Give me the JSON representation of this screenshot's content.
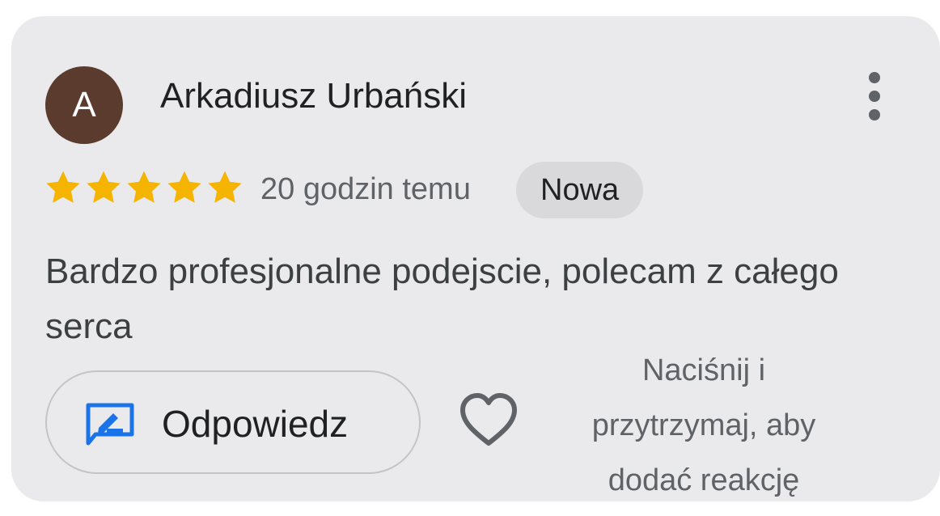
{
  "review": {
    "avatar_letter": "A",
    "author": "Arkadiusz Urbański",
    "rating": 5,
    "time": "20 godzin temu",
    "badge": "Nowa",
    "text": "Bardzo profesjonalne podejscie, polecam z całego serca"
  },
  "actions": {
    "reply_label": "Odpowiedz",
    "reaction_hint": "Naciśnij i przytrzymaj, aby dodać reakcję"
  },
  "icons": {
    "more": "more-vertical-icon",
    "star": "star-icon",
    "reply": "reply-edit-icon",
    "heart": "heart-outline-icon"
  },
  "colors": {
    "card_bg": "#eaeaec",
    "avatar_bg": "#5b3b2e",
    "star": "#f4b400",
    "reply_icon": "#1a73e8",
    "badge_bg": "#d9d9dc"
  }
}
